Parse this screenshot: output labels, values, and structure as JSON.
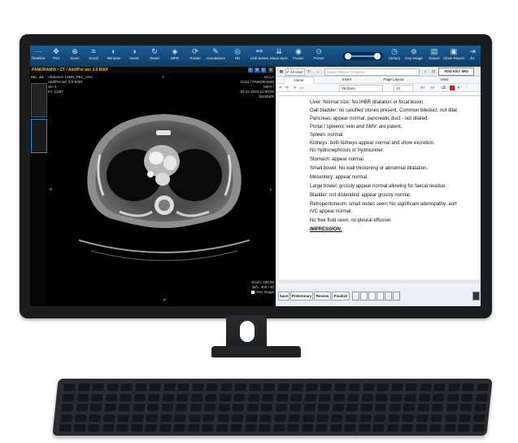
{
  "toolbar": {
    "tools": [
      {
        "label": "Timeline",
        "icon": "timeline-icon",
        "glyph": "⋯"
      },
      {
        "label": "Pan",
        "icon": "pan-icon",
        "glyph": "✥"
      },
      {
        "label": "Zoom",
        "icon": "zoom-icon",
        "glyph": "⊕"
      },
      {
        "label": "Scroll",
        "icon": "scroll-icon",
        "glyph": "≡"
      },
      {
        "label": "Window",
        "icon": "window-icon",
        "glyph": "◐"
      },
      {
        "label": "Invert",
        "icon": "invert-icon",
        "glyph": "◑"
      },
      {
        "label": "Reset",
        "icon": "reset-icon",
        "glyph": "↻"
      },
      {
        "label": "MPR",
        "icon": "mpr-icon",
        "glyph": "◈"
      },
      {
        "label": "Rotate",
        "icon": "rotate-icon",
        "glyph": "⟳"
      },
      {
        "label": "Annotations",
        "icon": "annotations-icon",
        "glyph": "✎"
      },
      {
        "label": "HU",
        "icon": "hu-icon",
        "glyph": "◎"
      },
      {
        "label": "Link Series",
        "icon": "link-series-icon",
        "glyph": "⚯"
      },
      {
        "label": "Stack Sync",
        "icon": "stack-sync-icon",
        "glyph": "⇊"
      },
      {
        "label": "Fusion",
        "icon": "fusion-icon",
        "glyph": "◉"
      },
      {
        "label": "Preset",
        "icon": "preset-icon",
        "glyph": "⊙"
      },
      {
        "label": "History",
        "icon": "history-icon",
        "glyph": "◷"
      },
      {
        "label": "Key Image",
        "icon": "key-image-icon",
        "glyph": "⊚"
      },
      {
        "label": "Report",
        "icon": "report-icon",
        "glyph": "▤"
      },
      {
        "label": "Close Report",
        "icon": "close-report-icon",
        "glyph": "▣"
      },
      {
        "label": "Ex",
        "icon": "exit-icon",
        "glyph": "⇥"
      }
    ]
  },
  "viewer": {
    "header": "PANORAMIX / CT / Abd/Pel w/c 3.0 B30f",
    "header_tools": [
      "A",
      "S",
      "C",
      "X"
    ],
    "top_left": [
      "Abdomen 1ABD_PEL_AAA",
      "Abd/Pel w/c 3.0 B30f",
      "Se: 4",
      "Im: 1/287"
    ],
    "top_right": [
      "UCLA",
      "11111 / PANORAMIX",
      "000Y /",
      "04-11-2024 12:00:00",
      "SENDER"
    ],
    "thumb_label": "PEL_AA",
    "orient_top": "A",
    "orient_left": "R",
    "orient_right": "L",
    "orient_bottom": "P",
    "bottom_right": [
      "Zoom: 208.59",
      "W/L: 400 / 40"
    ],
    "key_image_label": "Key Image"
  },
  "report": {
    "user": "All User",
    "template_placeholder": "Select Report Template",
    "add_key_img": "ADD KEY IMG",
    "tabs": [
      "Home",
      "Insert",
      "Page Layout",
      "View"
    ],
    "font": "Verdana",
    "font_size": "12",
    "text_color": "#d62020",
    "lines": [
      "Liver: Normal size; No IHBR dilatation or focal lesion.",
      "Gall bladder: no calcified stones present. Common bileduct: not dilat",
      "Pancreas: appear normal; pancreatic duct - not dilated.",
      "Portal / spleenic vein and SMV: are patent.",
      "Spleen: normal.",
      "Kidneys: both kidneys appear normal and show excretion.",
      "No hydronephrosis or hydroureter.",
      "Stomach: appear normal.",
      "Small bowel: No wall thickening or abnormal dilatation.",
      "Mesentery: appear normal.",
      "Large bowel: grossly appear normal allowing for faecal residue.",
      "Bladder: not distended; appear grossly normal.",
      "Retroperitoneum: small nodes seen; No significant adenopathy; aort",
      "IVC appear normal.",
      "No free fluid seen; no pleural effusion."
    ],
    "impression": "IMPRESSION:",
    "actions": [
      "Save",
      "Preliminary",
      "Review",
      "Finalize"
    ]
  },
  "colors": {
    "toolbar_top": "#1c5e96",
    "toolbar_bottom": "#0e3b63",
    "overlay_highlight": "#e2c62c"
  }
}
